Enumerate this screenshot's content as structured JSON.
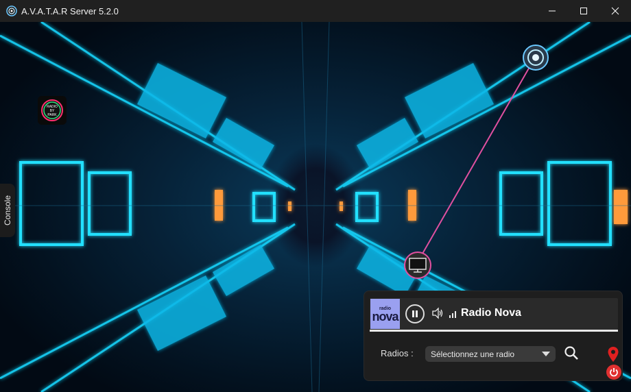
{
  "window": {
    "title": "A.V.A.T.A.R Server 5.2.0",
    "minimize_icon": "minimize-icon",
    "maximize_icon": "maximize-icon",
    "close_icon": "close-icon"
  },
  "sidebar": {
    "console_label": "Console"
  },
  "plugin_logo": {
    "lines": [
      "RADIO",
      "BY",
      "PARK"
    ]
  },
  "radio": {
    "logo_small": "radio",
    "logo_big": "nova",
    "station": "Radio Nova",
    "radios_label": "Radios :",
    "select_value": "Sélectionnez une radio",
    "accent_color": "#9aa0f0",
    "power_color": "#e03030",
    "pin_color": "#e02020"
  },
  "colors": {
    "titlebar": "#202020",
    "scene_cyan": "#18d8ff",
    "scene_orange": "#ff8a30",
    "link_line": "#e050a0"
  }
}
